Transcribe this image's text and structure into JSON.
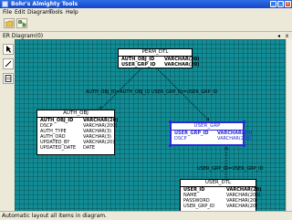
{
  "app": {
    "title": "Bohr's Almighty Tools",
    "minimize": "_",
    "maximize": "□",
    "close": "x"
  },
  "menu": [
    "File",
    "Edit",
    "Diagram",
    "Tools",
    "Help"
  ],
  "subwindow": {
    "title": "ER Diagram(0)",
    "float": "◂",
    "close": "x"
  },
  "relationships": [
    {
      "label": "AUTH_OBJ_ID=AUTH_OBJ_ID"
    },
    {
      "label": "USER_GRP_ID=USER_GRP_ID"
    },
    {
      "label": "USER_GRP_ID=USER_GRP_ID"
    }
  ],
  "entities": {
    "perm_dtl": {
      "name": "PERM_DTL",
      "rows": [
        {
          "col": "AUTH_OBJ_ID",
          "type": "VARCHAR(20)"
        },
        {
          "col": "USER_GRP_ID",
          "type": "VARCHAR(20)"
        }
      ]
    },
    "auth_obj": {
      "name": "AUTH_OBJ",
      "pk": {
        "col": "AUTH_OBJ_ID",
        "type": "VARCHAR(20)"
      },
      "rows": [
        {
          "col": "DSCP",
          "type": "VARCHAR(200)"
        },
        {
          "col": "AUTH_TYPE",
          "type": "VARCHAR(3)"
        },
        {
          "col": "AUTH_ORD",
          "type": "VARCHAR(3)"
        },
        {
          "col": "UPDATED_BY",
          "type": "VARCHAR(20)"
        },
        {
          "col": "UPDATED_DATE",
          "type": "DATE"
        }
      ]
    },
    "user_grp": {
      "name": "USER_GRP",
      "pk": {
        "col": "USER_GRP_ID",
        "type": "VARCHAR(20)"
      },
      "rows": [
        {
          "col": "DSCP",
          "type": "VARCHAR(200)"
        }
      ]
    },
    "user_dtl": {
      "name": "USER_DTL",
      "pk": {
        "col": "USER_ID",
        "type": "VARCHAR(20)"
      },
      "rows": [
        {
          "col": "NAME",
          "type": "VARCHAR(200)"
        },
        {
          "col": "PASSWORD",
          "type": "VARCHAR(20)"
        },
        {
          "col": "USER_GRP_ID",
          "type": "VARCHAR(20)"
        }
      ]
    }
  },
  "status": "Automatic layout all items in diagram."
}
